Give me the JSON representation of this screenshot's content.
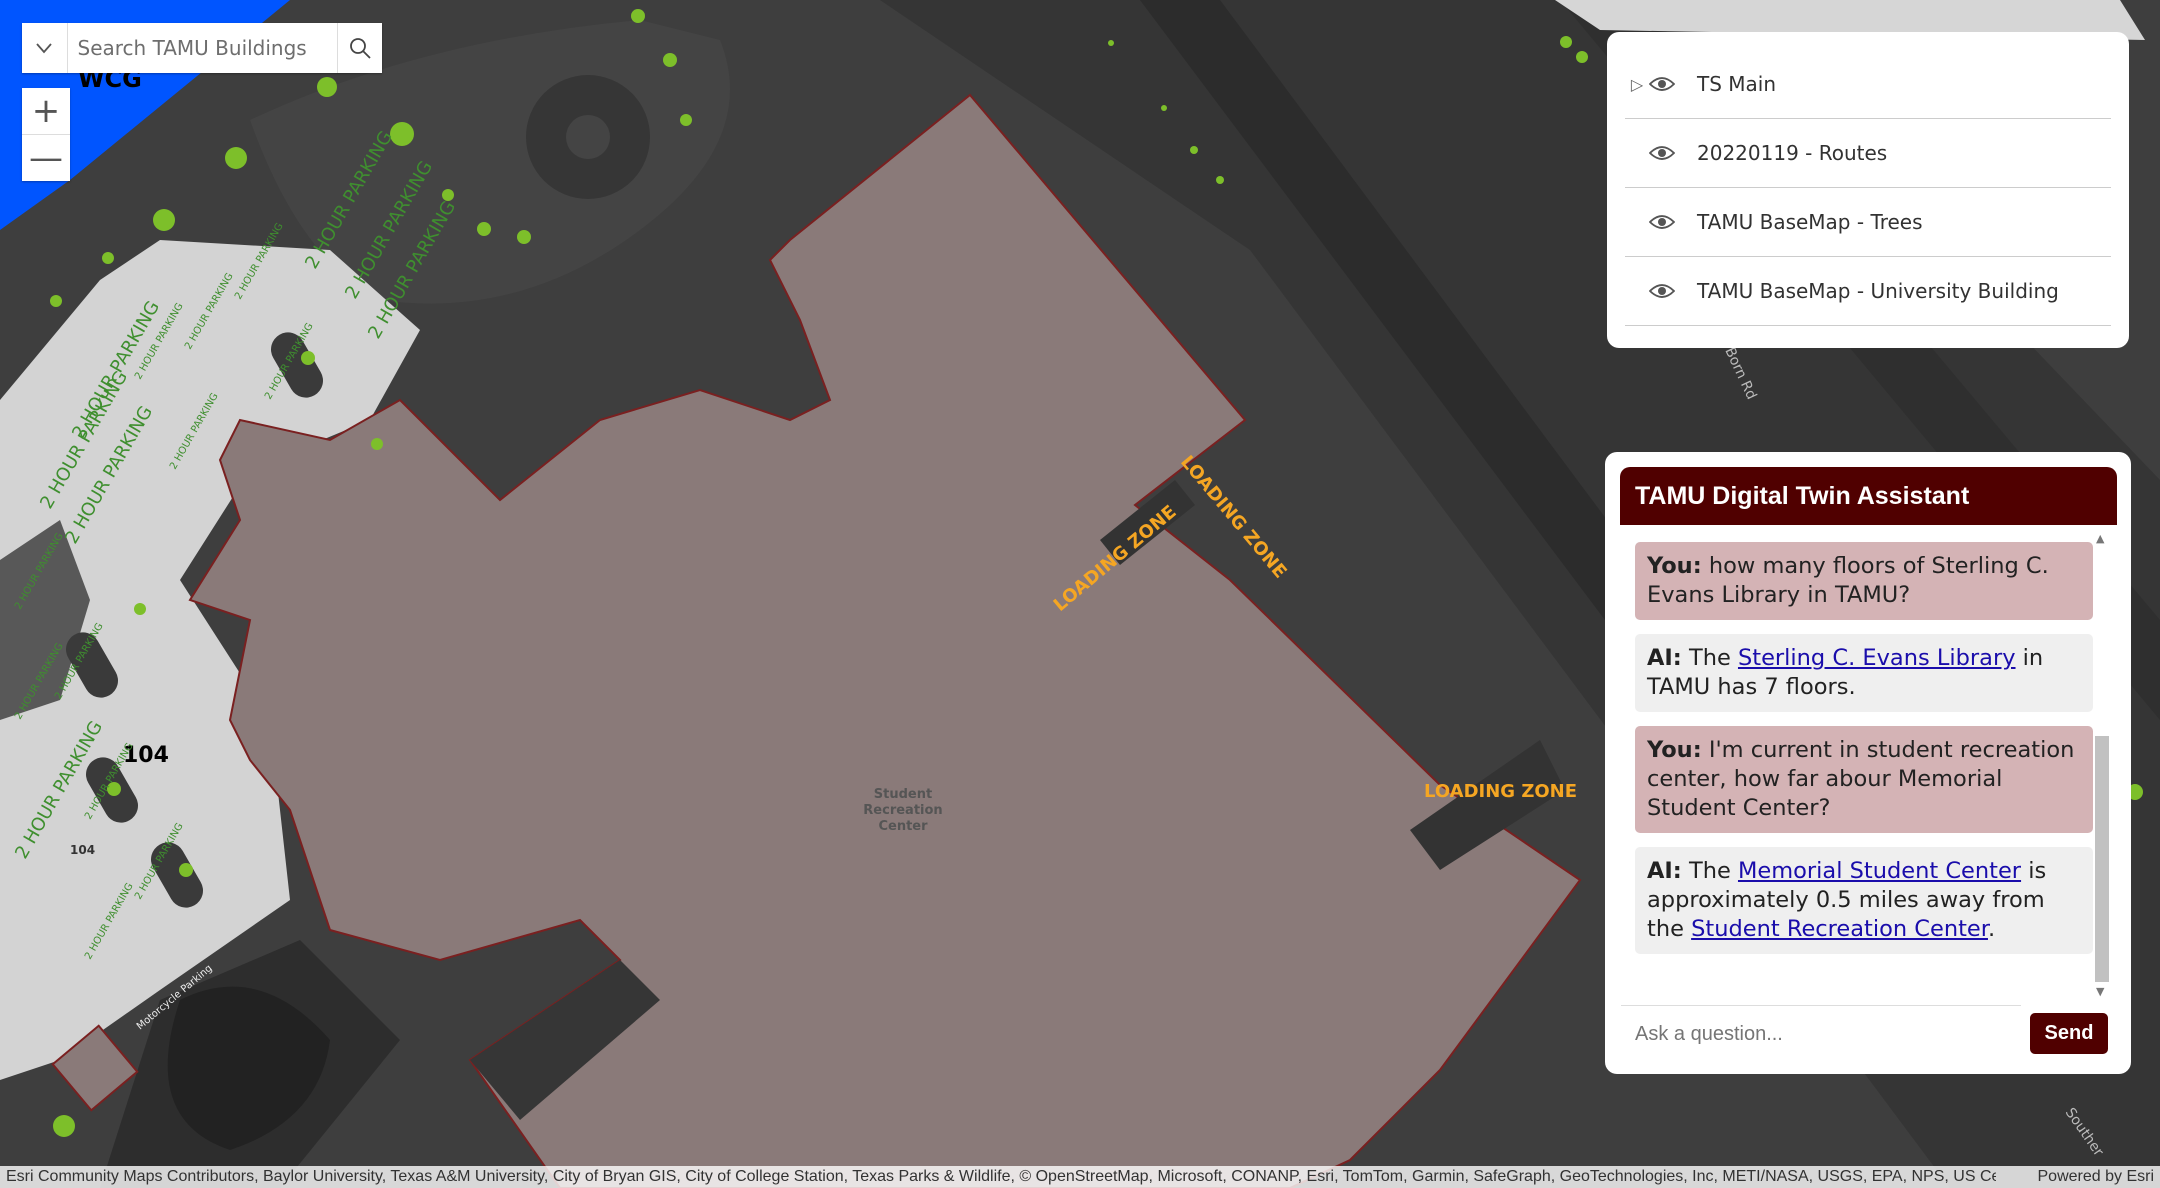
{
  "search": {
    "placeholder": "Search TAMU Buildings"
  },
  "zoom": {
    "in_label": "+",
    "out_label": "—"
  },
  "map": {
    "labels": {
      "wcg": "WCG",
      "lot_104": "104",
      "lot_104_small": "104",
      "student_rec": [
        "Student",
        "Recreation",
        "Center"
      ],
      "loading_zone": "LOADING ZONE",
      "two_hour_parking": "2 HOUR PARKING",
      "motorcycle_parking": "Motorcycle Parking",
      "born_rd": "Born Rd",
      "southern": "Souther"
    }
  },
  "layers": [
    {
      "label": "TS Main",
      "expandable": true
    },
    {
      "label": "20220119 - Routes",
      "expandable": false
    },
    {
      "label": "TAMU BaseMap - Trees",
      "expandable": false
    },
    {
      "label": "TAMU BaseMap - University Building",
      "expandable": false
    }
  ],
  "chat": {
    "title": "TAMU Digital Twin Assistant",
    "messages": [
      {
        "role": "you",
        "speaker": "You:",
        "text": "how many floors of Sterling C. Evans Library in TAMU?"
      },
      {
        "role": "ai",
        "speaker": "AI:",
        "pre": "The",
        "link": "Sterling C. Evans Library",
        "post": "in TAMU has 7 floors."
      },
      {
        "role": "you",
        "speaker": "You:",
        "text": "I'm current in student recreation center, how far abour Memorial Student Center?"
      },
      {
        "role": "ai",
        "speaker": "AI:",
        "pre": "The",
        "link": "Memorial Student Center",
        "mid": "is approximately 0.5 miles away from the",
        "link2": "Student Recreation Center",
        "post": "."
      }
    ],
    "input_placeholder": "Ask a question...",
    "send_label": "Send"
  },
  "attribution": {
    "text": "Esri Community Maps Contributors, Baylor University, Texas A&M University, City of Bryan GIS, City of College Station, Texas Parks & Wildlife, © OpenStreetMap, Microsoft, CONANP, Esri, TomTom, Garmin, SafeGraph, GeoTechnologies, Inc, METI/NASA, USGS, EPA, NPS, US Census Bureau, USDA, USFWS",
    "powered": "Powered by Esri"
  },
  "colors": {
    "building": "#8a7a79",
    "building_outline": "#7a2020",
    "parking_text": "#3f8f2f",
    "loading_zone": "#f5a623",
    "maroon": "#500000",
    "parking_lot": "#d3d3d3",
    "wcg_blue": "#0055ff"
  }
}
